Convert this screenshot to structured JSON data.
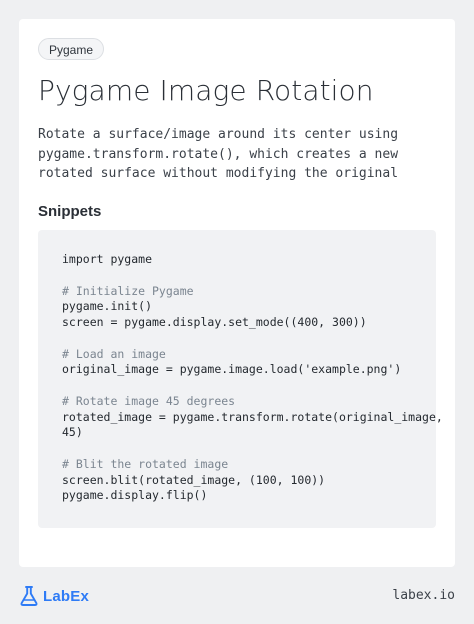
{
  "card": {
    "tag": "Pygame",
    "title": "Pygame Image Rotation",
    "description": "Rotate a surface/image around its center using pygame.transform.rotate(), which creates a new rotated surface without modifying the original",
    "section_heading": "Snippets",
    "code_lines": [
      {
        "text": "import pygame",
        "kind": "code"
      },
      {
        "text": "",
        "kind": "blank"
      },
      {
        "text": "# Initialize Pygame",
        "kind": "comment"
      },
      {
        "text": "pygame.init()",
        "kind": "code"
      },
      {
        "text": "screen = pygame.display.set_mode((400, 300))",
        "kind": "code"
      },
      {
        "text": "",
        "kind": "blank"
      },
      {
        "text": "# Load an image",
        "kind": "comment"
      },
      {
        "text": "original_image = pygame.image.load('example.png')",
        "kind": "code"
      },
      {
        "text": "",
        "kind": "blank"
      },
      {
        "text": "# Rotate image 45 degrees",
        "kind": "comment"
      },
      {
        "text": "rotated_image = pygame.transform.rotate(original_image,",
        "kind": "code"
      },
      {
        "text": "45)",
        "kind": "code"
      },
      {
        "text": "",
        "kind": "blank"
      },
      {
        "text": "# Blit the rotated image",
        "kind": "comment"
      },
      {
        "text": "screen.blit(rotated_image, (100, 100))",
        "kind": "code"
      },
      {
        "text": "pygame.display.flip()",
        "kind": "code"
      }
    ]
  },
  "footer": {
    "logo_text": "LabEx",
    "logo_icon": "flask-icon",
    "site": "labex.io"
  },
  "colors": {
    "page_background": "#eff0f2",
    "card_background": "#ffffff",
    "code_background": "#f1f2f4",
    "comment": "#7b8590",
    "brand": "#2e7bf6"
  }
}
